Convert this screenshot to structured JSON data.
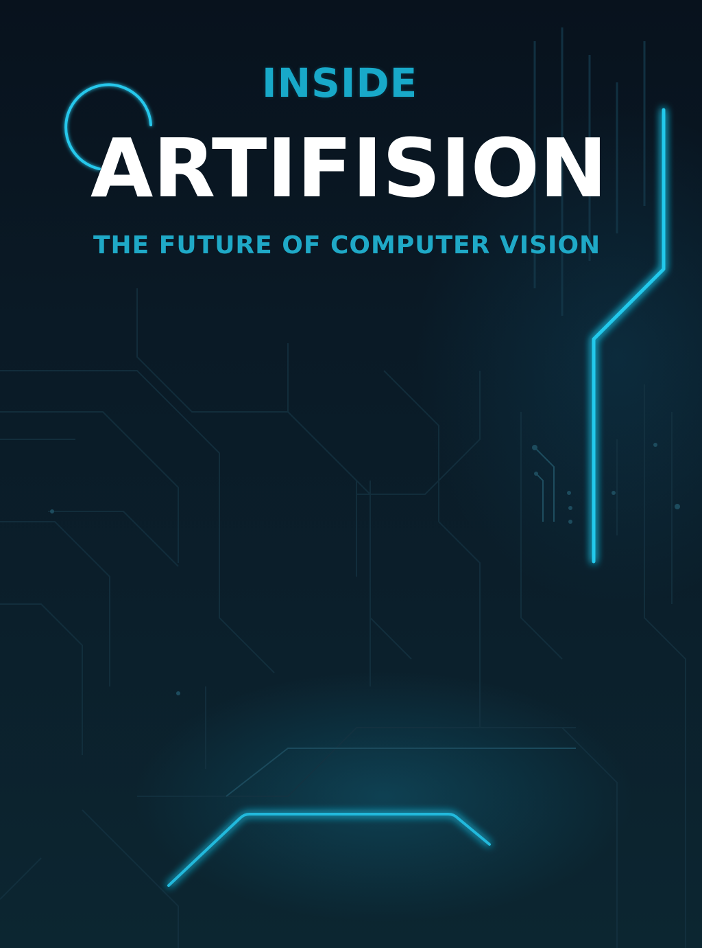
{
  "cover": {
    "kicker": "INSIDE",
    "title": "ARTIFISION",
    "subtitle": "THE FUTURE OF COMPUTER VISION"
  },
  "colors": {
    "background": "#08121d",
    "accent": "#18a9c9",
    "glow": "#2ed6f2",
    "title": "#ffffff"
  }
}
